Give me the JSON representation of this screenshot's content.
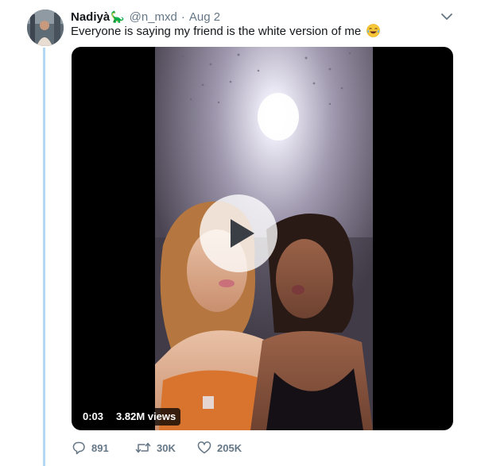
{
  "tweet": {
    "author_name": "Nadiyà",
    "author_emoji": "🦕",
    "handle": "@n_mxd",
    "separator": "·",
    "date": "Aug 2",
    "text": "Everyone is saying my friend is the white version of me",
    "text_emoji_icon": "face-with-tears-of-joy-icon"
  },
  "media": {
    "type": "video",
    "duration": "0:03",
    "views": "3.82M views"
  },
  "actions": {
    "reply_count": "891",
    "retweet_count": "30K",
    "like_count": "205K"
  },
  "colors": {
    "thread_line": "#b4d7f3",
    "text_secondary": "#657786",
    "text_primary": "#14171a"
  }
}
